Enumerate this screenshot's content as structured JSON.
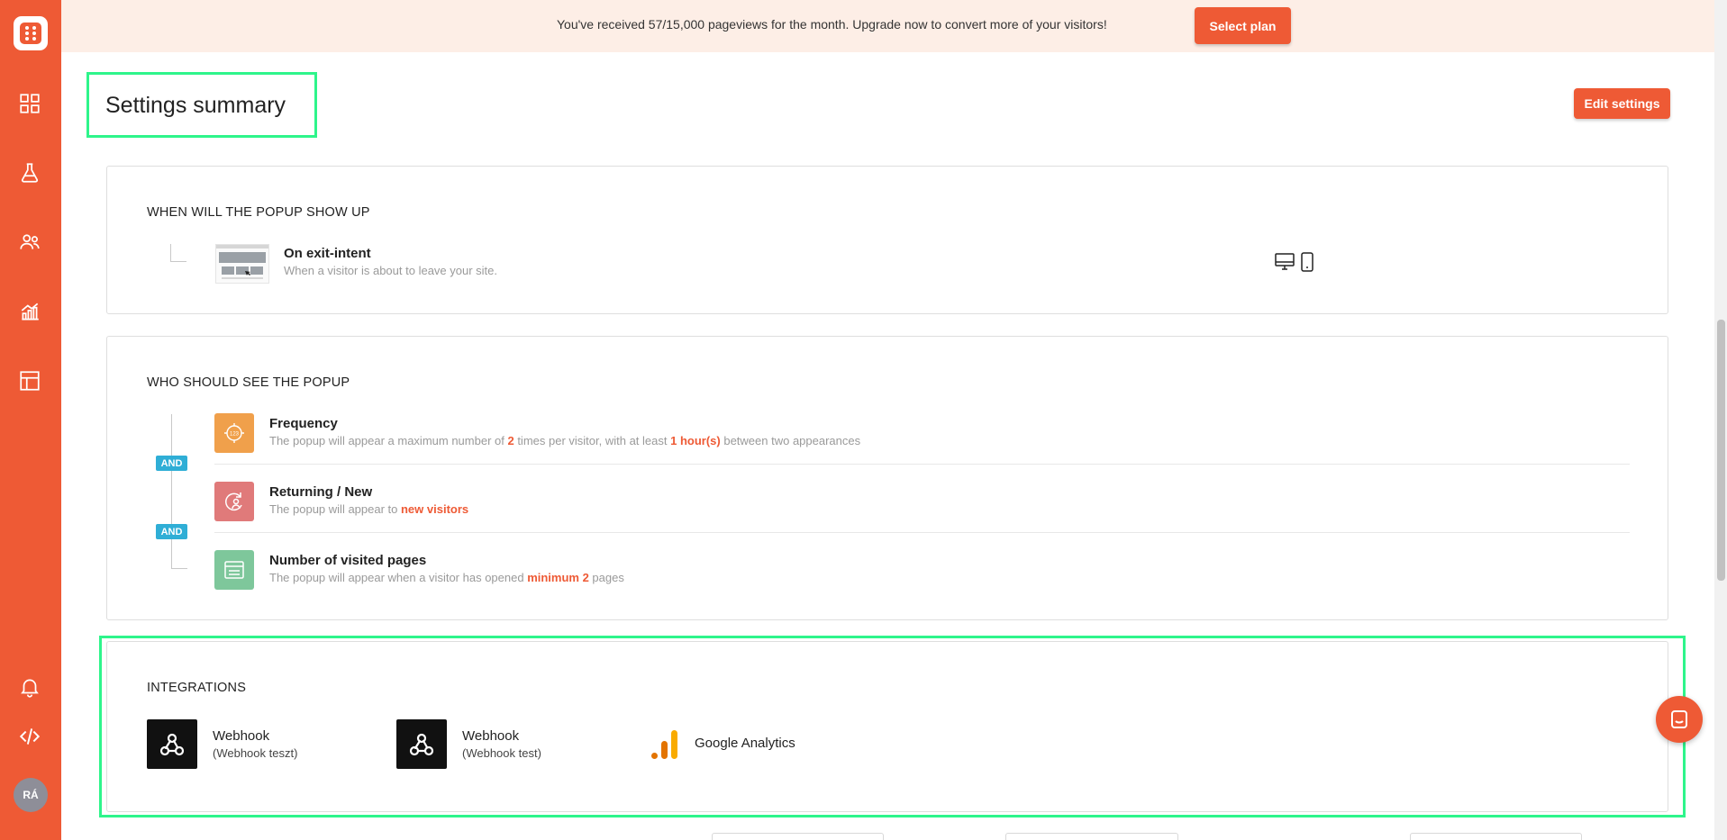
{
  "sidebar": {
    "logo": "logo-icon",
    "items": [
      {
        "icon": "dashboard-grid-icon"
      },
      {
        "icon": "flask-icon"
      },
      {
        "icon": "users-icon"
      },
      {
        "icon": "analytics-icon"
      },
      {
        "icon": "layout-icon"
      }
    ],
    "bottom": [
      {
        "icon": "bell-icon"
      },
      {
        "icon": "code-icon"
      }
    ],
    "avatar_initials": "RÁ"
  },
  "banner": {
    "message": "You've received 57/15,000 pageviews for the month. Upgrade now to convert more of your visitors!",
    "button_label": "Select plan"
  },
  "page": {
    "title": "Settings summary",
    "edit_button_label": "Edit settings"
  },
  "when_section": {
    "heading": "WHEN WILL THE POPUP SHOW UP",
    "trigger": {
      "title": "On exit-intent",
      "description": "When a visitor is about to leave your site."
    },
    "devices": [
      "desktop-icon",
      "mobile-icon"
    ]
  },
  "who_section": {
    "heading": "WHO SHOULD SEE THE POPUP",
    "and_label": "AND",
    "conditions": [
      {
        "title": "Frequency",
        "desc_parts": [
          "The popup will appear a maximum number of ",
          "2",
          " times per visitor, with at least ",
          "1 hour(s)",
          " between two appearances"
        ],
        "icon": "frequency-icon",
        "color": "#f0a04b"
      },
      {
        "title": "Returning / New",
        "desc_parts": [
          "The popup will appear to ",
          "new visitors"
        ],
        "icon": "returning-visitor-icon",
        "color": "#e07a7a"
      },
      {
        "title": "Number of visited pages",
        "desc_parts": [
          "The popup will appear when a visitor has opened ",
          "minimum 2",
          " pages"
        ],
        "icon": "visited-pages-icon",
        "color": "#7ec79b"
      }
    ]
  },
  "integrations": {
    "heading": "INTEGRATIONS",
    "items": [
      {
        "name": "Webhook",
        "sub": "(Webhook teszt)",
        "icon": "webhook-icon"
      },
      {
        "name": "Webhook",
        "sub": "(Webhook test)",
        "icon": "webhook-icon"
      },
      {
        "name": "Google Analytics",
        "icon": "google-analytics-icon"
      }
    ]
  },
  "colors": {
    "brand": "#ee5a35",
    "highlight_border": "#2ef58b",
    "and_badge": "#2faed6"
  }
}
